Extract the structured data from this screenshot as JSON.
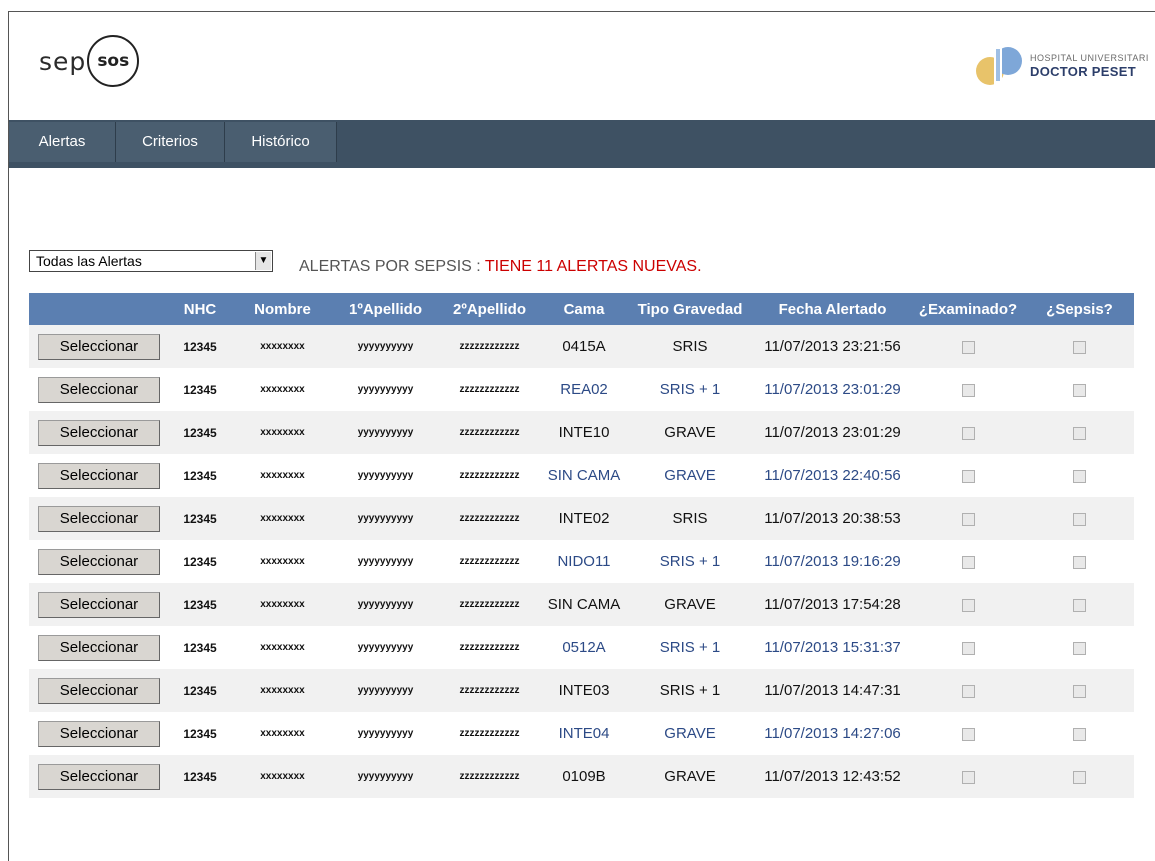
{
  "header": {
    "logo_prefix": "sep",
    "logo_circle": "sos",
    "hospital_line1": "HOSPITAL UNIVERSITARI",
    "hospital_line2": "DOCTOR PESET"
  },
  "nav": {
    "tabs": [
      {
        "label": "Alertas"
      },
      {
        "label": "Criterios"
      },
      {
        "label": "Histórico"
      }
    ]
  },
  "filter": {
    "selected": "Todas las Alertas",
    "message_prefix": "ALERTAS POR SEPSIS : ",
    "message_highlight": "TIENE 11 ALERTAS NUEVAS."
  },
  "table": {
    "columns": [
      "",
      "NHC",
      "Nombre",
      "1ºApellido",
      "2ºApellido",
      "Cama",
      "Tipo Gravedad",
      "Fecha Alertado",
      "¿Examinado?",
      "¿Sepsis?"
    ],
    "button_label": "Seleccionar",
    "rows": [
      {
        "nhc": "12345",
        "nombre": "xxxxxxxx",
        "ap1": "yyyyyyyyyy",
        "ap2": "zzzzzzzzzzzz",
        "cama": "0415A",
        "grav": "SRIS",
        "fecha": "11/07/2013 23:21:56",
        "highlight": false
      },
      {
        "nhc": "12345",
        "nombre": "xxxxxxxx",
        "ap1": "yyyyyyyyyy",
        "ap2": "zzzzzzzzzzzz",
        "cama": "REA02",
        "grav": "SRIS + 1",
        "fecha": "11/07/2013 23:01:29",
        "highlight": true
      },
      {
        "nhc": "12345",
        "nombre": "xxxxxxxx",
        "ap1": "yyyyyyyyyy",
        "ap2": "zzzzzzzzzzzz",
        "cama": "INTE10",
        "grav": "GRAVE",
        "fecha": "11/07/2013 23:01:29",
        "highlight": false
      },
      {
        "nhc": "12345",
        "nombre": "xxxxxxxx",
        "ap1": "yyyyyyyyyy",
        "ap2": "zzzzzzzzzzzz",
        "cama": "SIN CAMA",
        "grav": "GRAVE",
        "fecha": "11/07/2013 22:40:56",
        "highlight": true
      },
      {
        "nhc": "12345",
        "nombre": "xxxxxxxx",
        "ap1": "yyyyyyyyyy",
        "ap2": "zzzzzzzzzzzz",
        "cama": "INTE02",
        "grav": "SRIS",
        "fecha": "11/07/2013 20:38:53",
        "highlight": false
      },
      {
        "nhc": "12345",
        "nombre": "xxxxxxxx",
        "ap1": "yyyyyyyyyy",
        "ap2": "zzzzzzzzzzzz",
        "cama": "NIDO11",
        "grav": "SRIS + 1",
        "fecha": "11/07/2013 19:16:29",
        "highlight": true
      },
      {
        "nhc": "12345",
        "nombre": "xxxxxxxx",
        "ap1": "yyyyyyyyyy",
        "ap2": "zzzzzzzzzzzz",
        "cama": "SIN CAMA",
        "grav": "GRAVE",
        "fecha": "11/07/2013 17:54:28",
        "highlight": false
      },
      {
        "nhc": "12345",
        "nombre": "xxxxxxxx",
        "ap1": "yyyyyyyyyy",
        "ap2": "zzzzzzzzzzzz",
        "cama": "0512A",
        "grav": "SRIS + 1",
        "fecha": "11/07/2013 15:31:37",
        "highlight": true
      },
      {
        "nhc": "12345",
        "nombre": "xxxxxxxx",
        "ap1": "yyyyyyyyyy",
        "ap2": "zzzzzzzzzzzz",
        "cama": "INTE03",
        "grav": "SRIS + 1",
        "fecha": "11/07/2013 14:47:31",
        "highlight": false
      },
      {
        "nhc": "12345",
        "nombre": "xxxxxxxx",
        "ap1": "yyyyyyyyyy",
        "ap2": "zzzzzzzzzzzz",
        "cama": "INTE04",
        "grav": "GRAVE",
        "fecha": "11/07/2013 14:27:06",
        "highlight": true
      },
      {
        "nhc": "12345",
        "nombre": "xxxxxxxx",
        "ap1": "yyyyyyyyyy",
        "ap2": "zzzzzzzzzzzz",
        "cama": "0109B",
        "grav": "GRAVE",
        "fecha": "11/07/2013 12:43:52",
        "highlight": false
      }
    ]
  },
  "colors": {
    "nav_bg": "#3e5163",
    "table_header": "#5b7fb1",
    "highlight_text": "#2c4a86",
    "alert_red": "#cc0000"
  }
}
